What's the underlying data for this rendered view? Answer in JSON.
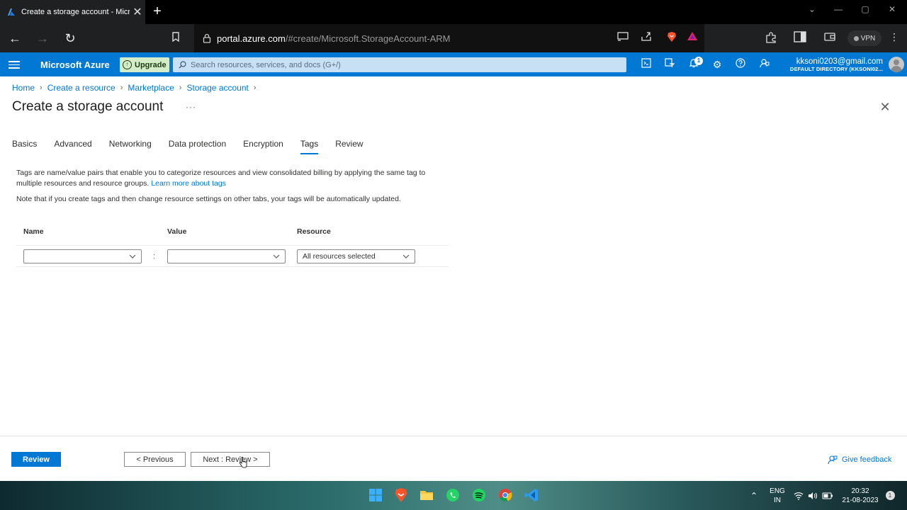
{
  "browser": {
    "tab_title": "Create a storage account - Micr",
    "url_host": "portal.azure.com",
    "url_path": "/#create/Microsoft.StorageAccount-ARM",
    "vpn_label": "VPN"
  },
  "azure_header": {
    "brand": "Microsoft Azure",
    "upgrade_label": "Upgrade",
    "search_placeholder": "Search resources, services, and docs (G+/)",
    "notification_count": "1",
    "account_email": "kksoni0203@gmail.com",
    "account_directory": "DEFAULT DIRECTORY (KKSONI02..."
  },
  "breadcrumb": [
    "Home",
    "Create a resource",
    "Marketplace",
    "Storage account"
  ],
  "page": {
    "title": "Create a storage account",
    "ellipsis": "···"
  },
  "tabs": [
    {
      "label": "Basics"
    },
    {
      "label": "Advanced"
    },
    {
      "label": "Networking"
    },
    {
      "label": "Data protection"
    },
    {
      "label": "Encryption"
    },
    {
      "label": "Tags",
      "active": true
    },
    {
      "label": "Review"
    }
  ],
  "content": {
    "description": "Tags are name/value pairs that enable you to categorize resources and view consolidated billing by applying the same tag to multiple resources and resource groups.",
    "learn_more": "Learn more about tags",
    "note": "Note that if you create tags and then change resource settings on other tabs, your tags will be automatically updated."
  },
  "tag_table": {
    "headers": {
      "name": "Name",
      "value": "Value",
      "resource": "Resource"
    },
    "row": {
      "name": "",
      "value": "",
      "separator": ":",
      "resource": "All resources selected"
    }
  },
  "footer": {
    "review_label": "Review",
    "previous_label": "< Previous",
    "next_label": "Next : Review >",
    "feedback_label": "Give feedback"
  },
  "taskbar": {
    "lang_line1": "ENG",
    "lang_line2": "IN",
    "time": "20:32",
    "date": "21-08-2023",
    "notification_badge": "1"
  },
  "colors": {
    "azure_blue": "#0078d4",
    "upgrade_green": "#d4ecc8"
  }
}
